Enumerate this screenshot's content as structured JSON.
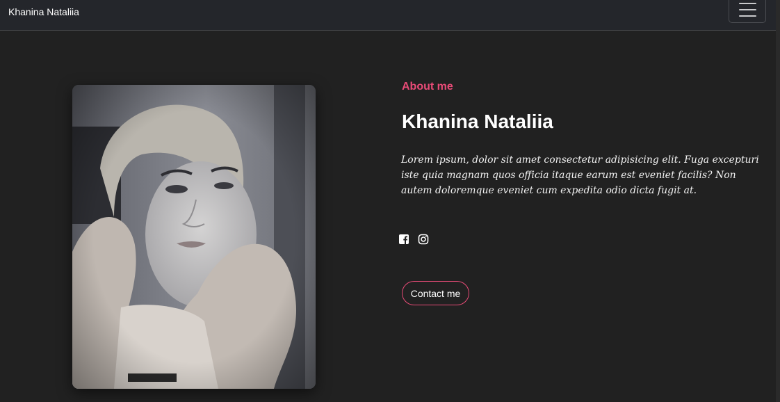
{
  "navbar": {
    "brand": "Khanina Nataliia",
    "toggler_icon": "hamburger-menu-icon"
  },
  "profile": {
    "photo_alt": "Khanina Nataliia",
    "about_label": "About me",
    "name": "Khanina Nataliia",
    "bio": "Lorem ipsum, dolor sit amet consectetur adipisicing elit. Fuga excepturi iste quia magnam quos officia itaque earum est eveniet facilis? Non autem doloremque eveniet cum expedita odio dicta fugit at.",
    "socials": [
      {
        "icon": "facebook-icon"
      },
      {
        "icon": "instagram-icon"
      }
    ],
    "contact_label": "Contact me"
  },
  "colors": {
    "accent": "#e84b77",
    "background": "#212121",
    "navbar": "#24262b"
  }
}
